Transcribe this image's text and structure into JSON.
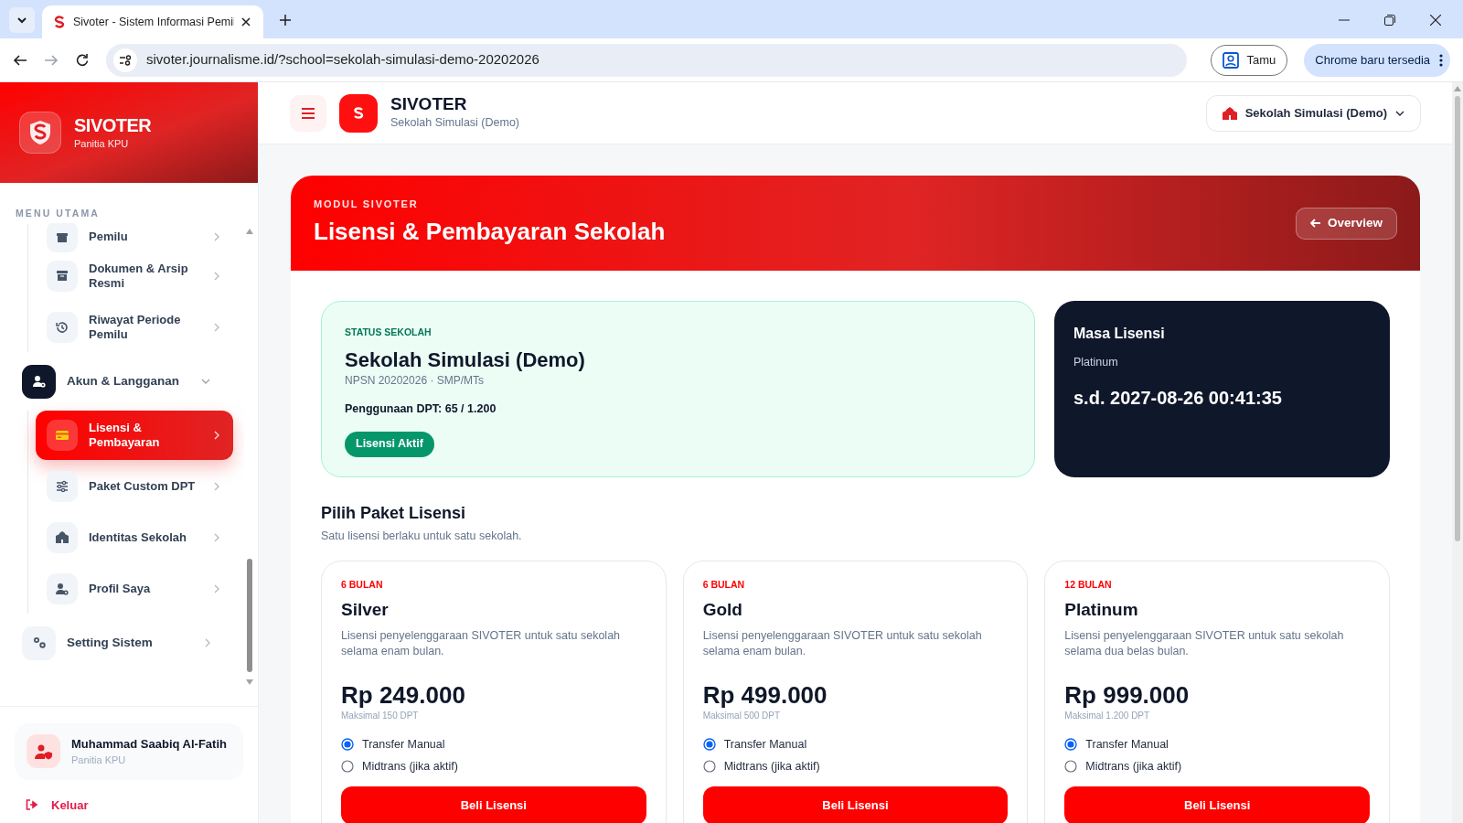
{
  "browser": {
    "tab_title": "Sivoter - Sistem Informasi Pemil",
    "url": "sivoter.journalisme.id/?school=sekolah-simulasi-demo-20202026",
    "profile": "Tamu",
    "update_chip": "Chrome baru tersedia"
  },
  "sidebar": {
    "brand": "SIVOTER",
    "role": "Panitia KPU",
    "section_label": "MENU UTAMA",
    "scrolled_group_children": [
      {
        "label": "Pemilu",
        "selected": false
      },
      {
        "label": "Dokumen & Arsip Resmi",
        "selected": false
      },
      {
        "label": "Riwayat Periode Pemilu",
        "selected": false
      }
    ],
    "groups": [
      {
        "label": "Akun & Langganan",
        "expanded": true,
        "children": [
          {
            "label": "Lisensi & Pembayaran",
            "selected": true
          },
          {
            "label": "Paket Custom DPT",
            "selected": false
          },
          {
            "label": "Identitas Sekolah",
            "selected": false
          },
          {
            "label": "Profil Saya",
            "selected": false
          }
        ]
      },
      {
        "label": "Setting Sistem",
        "expanded": false
      }
    ],
    "user": {
      "name": "Muhammad Saabiq Al-Fatih",
      "role": "Panitia KPU"
    },
    "logout": "Keluar"
  },
  "header": {
    "app_name": "SIVOTER",
    "school": "Sekolah Simulasi (Demo)",
    "school_selector": "Sekolah Simulasi (Demo)"
  },
  "banner": {
    "eyebrow": "MODUL SIVOTER",
    "title": "Lisensi & Pembayaran Sekolah",
    "back_button": "Overview"
  },
  "status": {
    "eyebrow": "STATUS SEKOLAH",
    "name": "Sekolah Simulasi (Demo)",
    "meta": "NPSN 20202026 · SMP/MTs",
    "usage": "Penggunaan DPT: 65 / 1.200",
    "badge": "Lisensi Aktif"
  },
  "license_period": {
    "title": "Masa Lisensi",
    "plan": "Platinum",
    "until": "s.d. 2027-08-26 00:41:35"
  },
  "plans_section": {
    "title": "Pilih Paket Lisensi",
    "subtitle": "Satu lisensi berlaku untuk satu sekolah."
  },
  "plans": [
    {
      "duration": "6 BULAN",
      "name": "Silver",
      "description": "Lisensi penyelenggaraan SIVOTER untuk satu sekolah selama enam bulan.",
      "price": "Rp 249.000",
      "limit": "Maksimal 150 DPT",
      "payment_options": [
        {
          "label": "Transfer Manual",
          "selected": true
        },
        {
          "label": "Midtrans (jika aktif)",
          "selected": false
        }
      ],
      "button": "Beli Lisensi"
    },
    {
      "duration": "6 BULAN",
      "name": "Gold",
      "description": "Lisensi penyelenggaraan SIVOTER untuk satu sekolah selama enam bulan.",
      "price": "Rp 499.000",
      "limit": "Maksimal 500 DPT",
      "payment_options": [
        {
          "label": "Transfer Manual",
          "selected": true
        },
        {
          "label": "Midtrans (jika aktif)",
          "selected": false
        }
      ],
      "button": "Beli Lisensi"
    },
    {
      "duration": "12 BULAN",
      "name": "Platinum",
      "description": "Lisensi penyelenggaraan SIVOTER untuk satu sekolah selama dua belas bulan.",
      "price": "Rp 999.000",
      "limit": "Maksimal 1.200 DPT",
      "payment_options": [
        {
          "label": "Transfer Manual",
          "selected": true
        },
        {
          "label": "Midtrans (jika aktif)",
          "selected": false
        }
      ],
      "button": "Beli Lisensi"
    }
  ]
}
